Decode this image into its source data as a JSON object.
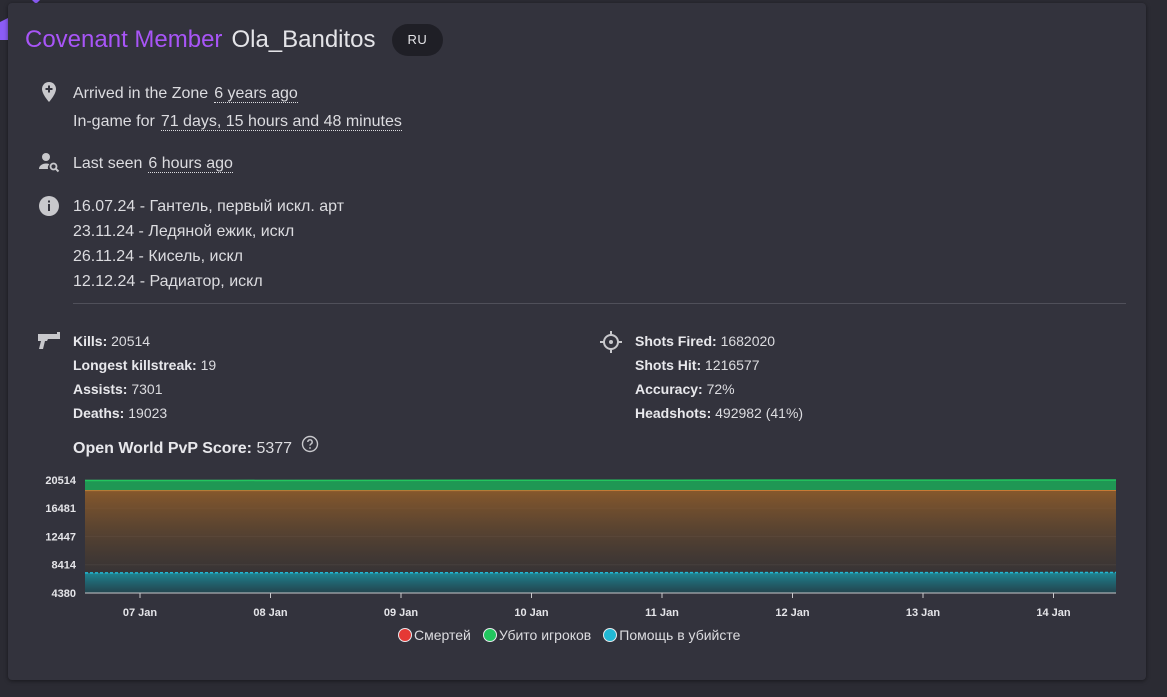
{
  "header": {
    "rank": "Covenant Member",
    "player_name": "Ola_Banditos",
    "region": "RU"
  },
  "arrival": {
    "label": "Arrived in the Zone",
    "value": "6 years ago",
    "ingame_label": "In-game for",
    "ingame_value": "71 days, 15 hours and 48 minutes",
    "icon": "map-pin-plus-icon"
  },
  "last_seen": {
    "label": "Last seen",
    "value": "6 hours ago",
    "icon": "person-search-icon"
  },
  "notes": {
    "icon": "info-icon",
    "items": [
      "16.07.24 - Гантель, первый искл. арт",
      "23.11.24 - Ледяной ежик, искл",
      "26.11.24 - Кисель, искл",
      "12.12.24 - Радиатор, искл"
    ]
  },
  "combat": {
    "icon": "pistol-icon",
    "kills_label": "Kills:",
    "kills": "20514",
    "streak_label": "Longest killstreak:",
    "streak": "19",
    "assists_label": "Assists:",
    "assists": "7301",
    "deaths_label": "Deaths:",
    "deaths": "19023"
  },
  "shooting": {
    "icon": "crosshair-icon",
    "fired_label": "Shots Fired:",
    "fired": "1682020",
    "hit_label": "Shots Hit:",
    "hit": "1216577",
    "accuracy_label": "Accuracy:",
    "accuracy": "72%",
    "headshots_label": "Headshots:",
    "headshots": "492982 (41%)"
  },
  "pvp": {
    "label": "Open World PvP Score:",
    "value": "5377",
    "help_icon": "help-circle-icon"
  },
  "chart_data": {
    "type": "area",
    "x": [
      "07 Jan",
      "08 Jan",
      "09 Jan",
      "10 Jan",
      "11 Jan",
      "12 Jan",
      "13 Jan",
      "14 Jan"
    ],
    "y_ticks": [
      20514,
      16481,
      12447,
      8414,
      4380
    ],
    "ylim": [
      4380,
      20514
    ],
    "grid": true,
    "legend_position": "bottom",
    "series": [
      {
        "name": "Смертей",
        "color": "#e53935",
        "fill": "#8a5a2b",
        "values": [
          18990,
          18995,
          19000,
          19005,
          19010,
          19015,
          19018,
          19023
        ]
      },
      {
        "name": "Убито игроков",
        "color": "#22c55e",
        "fill": "#1f9d55",
        "values": [
          20440,
          20450,
          20460,
          20475,
          20485,
          20495,
          20505,
          20514
        ]
      },
      {
        "name": "Помощь в убийсте",
        "color": "#22b8d4",
        "fill": "#1c8f9e",
        "values": [
          7260,
          7265,
          7270,
          7275,
          7282,
          7288,
          7295,
          7301
        ]
      }
    ]
  }
}
